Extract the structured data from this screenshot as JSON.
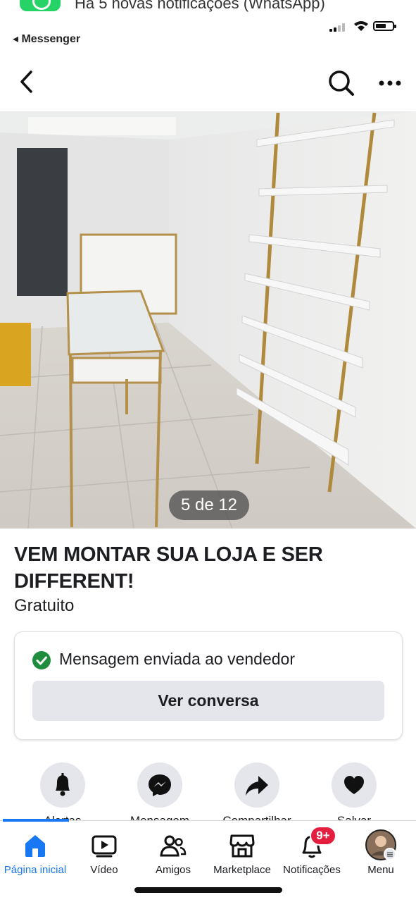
{
  "notification": {
    "text": "Há 5 novas notificações (WhatsApp)",
    "app_icon": "whatsapp-icon"
  },
  "status_bar": {
    "back_app": "◂ Messenger"
  },
  "nav": {
    "back_icon": "chevron-left-icon",
    "search_icon": "search-icon",
    "more_icon": "more-horizontal-icon"
  },
  "photo": {
    "counter": "5 de 12"
  },
  "listing": {
    "title": "VEM MONTAR SUA LOJA E SER DIFFERENT!",
    "price": "Gratuito"
  },
  "message_card": {
    "status_text": "Mensagem enviada ao vendedor",
    "button_label": "Ver conversa"
  },
  "actions": [
    {
      "icon": "bell-icon",
      "label": "Alertas"
    },
    {
      "icon": "messenger-icon",
      "label": "Mensagem"
    },
    {
      "icon": "share-icon",
      "label": "Compartilhar"
    },
    {
      "icon": "heart-icon",
      "label": "Salvar"
    }
  ],
  "tabs": [
    {
      "icon": "home-icon",
      "label": "Página inicial",
      "active": true
    },
    {
      "icon": "video-icon",
      "label": "Vídeo"
    },
    {
      "icon": "friends-icon",
      "label": "Amigos"
    },
    {
      "icon": "marketplace-icon",
      "label": "Marketplace"
    },
    {
      "icon": "notifications-icon",
      "label": "Notificações",
      "badge": "9+"
    },
    {
      "icon": "avatar-icon",
      "label": "Menu"
    }
  ],
  "colors": {
    "accent": "#1877f2",
    "badge": "#e41e3f",
    "success": "#1e8e3e",
    "button_bg": "#e4e6eb"
  }
}
